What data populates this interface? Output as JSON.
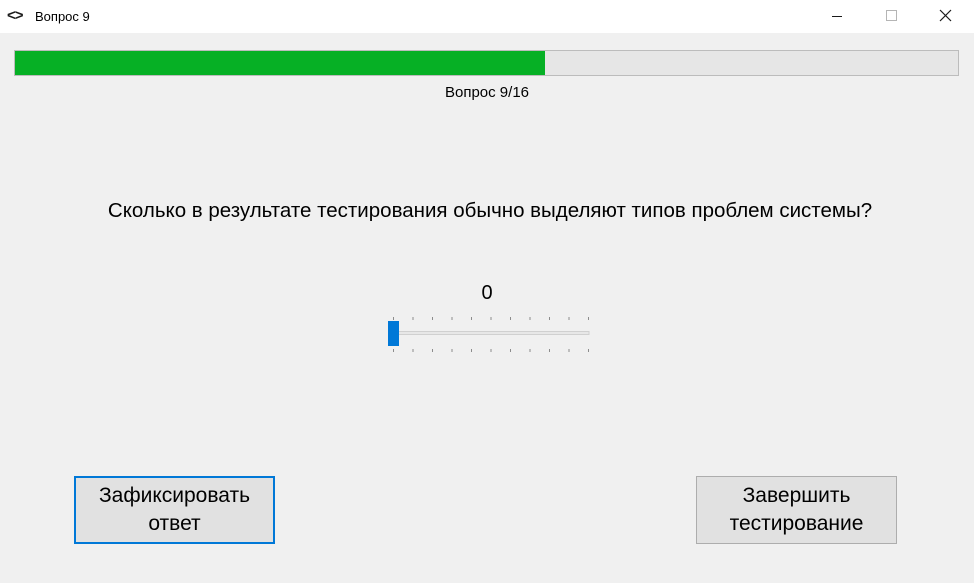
{
  "window": {
    "title": "Вопрос 9",
    "icon": "code-brackets-icon",
    "controls": [
      "minimize-icon",
      "maximize-icon",
      "close-icon"
    ]
  },
  "progress": {
    "label": "Вопрос 9/16",
    "current": 9,
    "total": 16,
    "fill_fraction": 0.5625,
    "fill_color": "#06b025"
  },
  "question": {
    "text": "Сколько в результате тестирования обычно выделяют типов проблем системы?"
  },
  "slider": {
    "value": "0",
    "min": 0,
    "max": 10,
    "accent": "#0078d7"
  },
  "buttons": {
    "submit_label": "Зафиксировать ответ",
    "finish_label": "Завершить тестирование"
  }
}
